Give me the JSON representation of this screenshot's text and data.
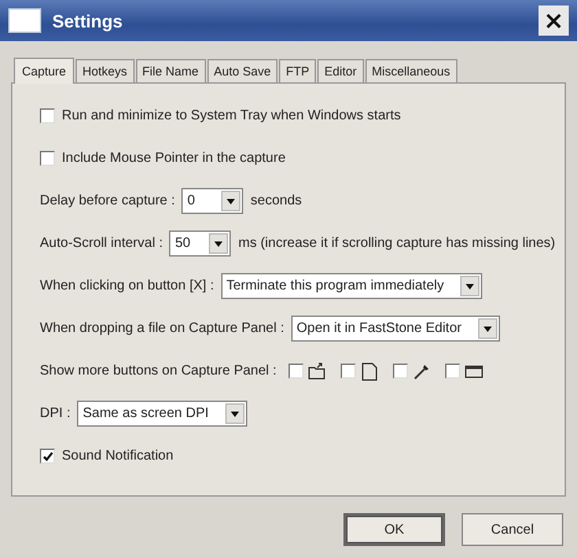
{
  "window": {
    "title": "Settings",
    "close": "×"
  },
  "tabs": [
    {
      "label": "Capture",
      "selected": true
    },
    {
      "label": "Hotkeys",
      "selected": false
    },
    {
      "label": "File Name",
      "selected": false
    },
    {
      "label": "Auto Save",
      "selected": false
    },
    {
      "label": "FTP",
      "selected": false
    },
    {
      "label": "Editor",
      "selected": false
    },
    {
      "label": "Miscellaneous",
      "selected": false
    }
  ],
  "rows": [
    {
      "kind": "checkbox",
      "label": "Run and minimize to System Tray when Windows starts",
      "checked": false
    },
    {
      "kind": "checkbox",
      "label": "Include Mouse Pointer in the capture",
      "checked": false
    },
    {
      "kind": "select",
      "label": "Delay before capture :",
      "value": "0",
      "suffix": "seconds"
    },
    {
      "kind": "select",
      "label": "Auto-Scroll interval :",
      "value": "50",
      "suffix": "ms (increase it if scrolling capture has missing lines)"
    },
    {
      "kind": "select",
      "label": "When clicking on button [X] :",
      "value": "Terminate this program immediately"
    },
    {
      "kind": "select",
      "label": "When dropping a file on Capture Panel :",
      "value": "Open it in FastStone Editor"
    },
    {
      "kind": "buttons",
      "label": "Show more buttons on Capture Panel :",
      "items": [
        {
          "checked": false
        },
        {
          "checked": false
        },
        {
          "checked": false
        },
        {
          "checked": false
        }
      ]
    },
    {
      "kind": "select",
      "label": "DPI :",
      "value": "Same as screen DPI"
    },
    {
      "kind": "checkbox",
      "label": "Sound Notification",
      "checked": true
    }
  ],
  "buttons": [
    {
      "label": "OK",
      "default": true
    },
    {
      "label": "Cancel",
      "default": false
    }
  ]
}
